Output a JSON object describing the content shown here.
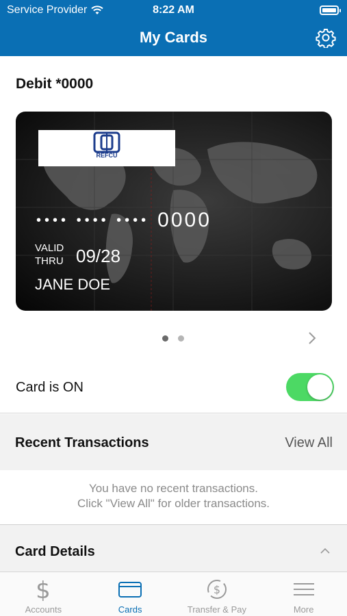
{
  "status_bar": {
    "carrier": "Service Provider",
    "time": "8:22 AM"
  },
  "header": {
    "title": "My Cards",
    "settings_icon": "gear-icon"
  },
  "card": {
    "label": "Debit *0000",
    "logo_text": "REFCU",
    "masked_number": "•••• •••• ••••",
    "last4": "0000",
    "valid_thru_label": "VALID\nTHRU",
    "expiry": "09/28",
    "holder": "JANE DOE"
  },
  "pager": {
    "pages": 2,
    "active": 1
  },
  "card_toggle": {
    "label": "Card is ON",
    "on": true,
    "color": "#4cd964"
  },
  "recent": {
    "title": "Recent Transactions",
    "view_all": "View All",
    "empty_line1": "You have no recent transactions.",
    "empty_line2": "Click \"View All\" for older transactions."
  },
  "details": {
    "title": "Card Details"
  },
  "tabs": [
    {
      "label": "Accounts",
      "icon": "dollar-icon",
      "active": false
    },
    {
      "label": "Cards",
      "icon": "card-icon",
      "active": true
    },
    {
      "label": "Transfer & Pay",
      "icon": "transfer-icon",
      "active": false
    },
    {
      "label": "More",
      "icon": "menu-icon",
      "active": false
    }
  ],
  "colors": {
    "brand": "#0a6fb4",
    "toggle_on": "#4cd964"
  }
}
